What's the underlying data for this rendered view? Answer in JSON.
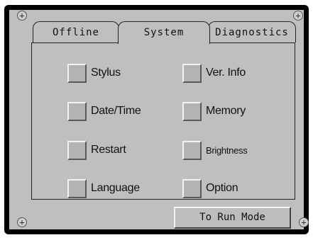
{
  "tabs": [
    {
      "label": "Offline"
    },
    {
      "label": "System"
    },
    {
      "label": "Diagnostics"
    }
  ],
  "active_tab": "System",
  "buttons": {
    "left": [
      {
        "label": "Stylus"
      },
      {
        "label": "Date/Time"
      },
      {
        "label": "Restart"
      },
      {
        "label": "Language"
      }
    ],
    "right": [
      {
        "label": "Ver. Info"
      },
      {
        "label": "Memory"
      },
      {
        "label": "Brightness"
      },
      {
        "label": "Option"
      }
    ]
  },
  "run_mode_button": {
    "label": "To Run Mode"
  },
  "colors": {
    "panel": "#bfbfbf",
    "bezel": "#000000"
  }
}
